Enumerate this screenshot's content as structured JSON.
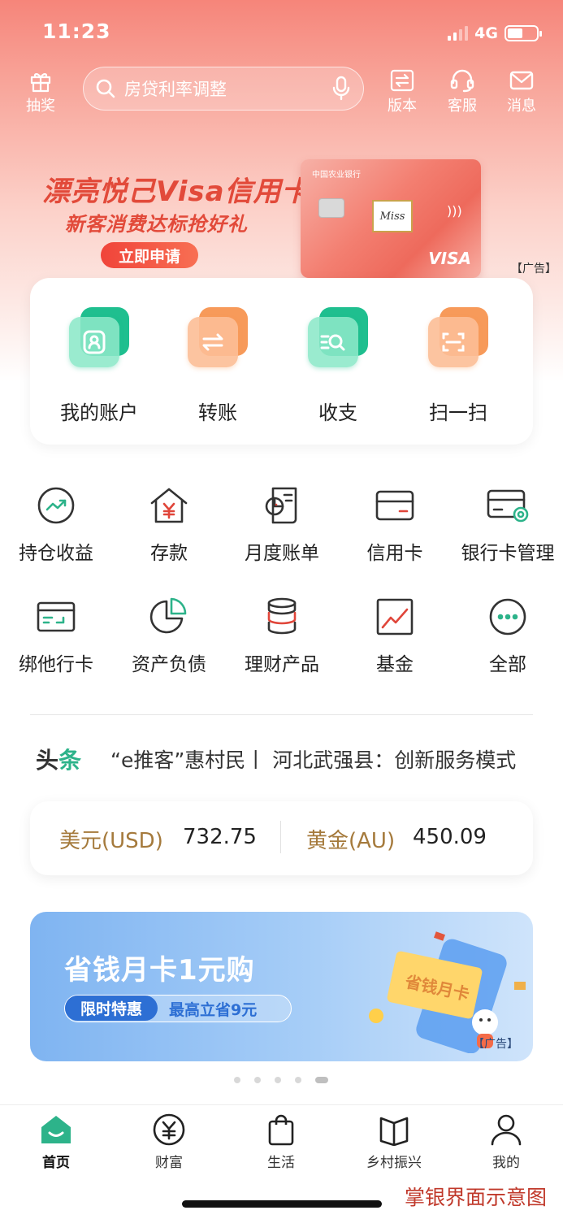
{
  "status_bar": {
    "time": "11:23",
    "network": "4G"
  },
  "header": {
    "lottery_label": "抽奖",
    "search_text": "房贷利率调整",
    "version_label": "版本",
    "service_label": "客服",
    "message_label": "消息"
  },
  "banner_ad": {
    "title": "漂亮悦己Visa信用卡",
    "subtitle": "新客消费达标抢好礼",
    "button": "立即申请",
    "card_bank": "中国农业银行",
    "card_signature": "Miss",
    "card_brand": "VISA",
    "ad_tag": "【广告】"
  },
  "quick_actions": [
    {
      "label": "我的账户",
      "icon": "account-icon",
      "color": "green"
    },
    {
      "label": "转账",
      "icon": "transfer-icon",
      "color": "orange"
    },
    {
      "label": "收支",
      "icon": "income-expense-icon",
      "color": "green"
    },
    {
      "label": "扫一扫",
      "icon": "scan-icon",
      "color": "orange"
    }
  ],
  "services": [
    {
      "label": "持仓收益",
      "icon": "holdings-income-icon"
    },
    {
      "label": "存款",
      "icon": "deposit-icon"
    },
    {
      "label": "月度账单",
      "icon": "monthly-bill-icon"
    },
    {
      "label": "信用卡",
      "icon": "credit-card-icon"
    },
    {
      "label": "银行卡管理",
      "icon": "card-management-icon"
    },
    {
      "label": "绑他行卡",
      "icon": "bind-card-icon"
    },
    {
      "label": "资产负债",
      "icon": "assets-liabilities-icon"
    },
    {
      "label": "理财产品",
      "icon": "wealth-products-icon"
    },
    {
      "label": "基金",
      "icon": "fund-icon"
    },
    {
      "label": "全部",
      "icon": "more-icon"
    }
  ],
  "headline": {
    "tag_part1": "头",
    "tag_part2": "条",
    "text": "“e推客”惠村民丨 河北武强县：创新服务模式"
  },
  "rates": {
    "usd_label": "美元(USD)",
    "usd_value": "732.75",
    "gold_label": "黄金(AU)",
    "gold_value": "450.09"
  },
  "promo": {
    "title": "省钱月卡1元购",
    "badge": "限时特惠",
    "desc": "最高立省9元",
    "art_text": "省钱月卡",
    "ad_tag": "【广告】",
    "page_count": 5,
    "active_page": 5
  },
  "tabs": [
    {
      "label": "首页",
      "icon": "home-icon",
      "active": true
    },
    {
      "label": "财富",
      "icon": "wealth-icon",
      "active": false
    },
    {
      "label": "生活",
      "icon": "life-bag-icon",
      "active": false
    },
    {
      "label": "乡村振兴",
      "icon": "rural-revitalization-icon",
      "active": false
    },
    {
      "label": "我的",
      "icon": "profile-icon",
      "active": false
    }
  ],
  "caption": "掌银界面示意图",
  "colors": {
    "brand_green": "#2db38a",
    "header_coral": "#f6857a",
    "gold_text": "#a57a3c",
    "promo_blue": "#2d6fd4"
  }
}
